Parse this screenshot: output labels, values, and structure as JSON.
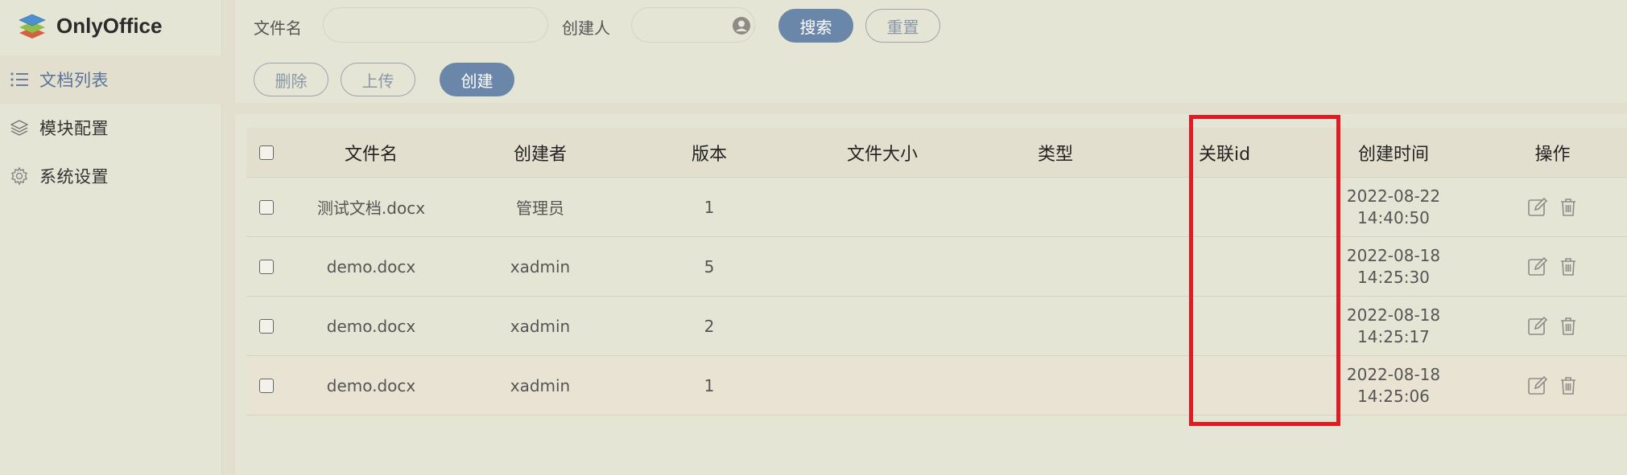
{
  "brand": {
    "name": "OnlyOffice",
    "icon": "stacked-layers-logo-icon"
  },
  "sidebar": {
    "items": [
      {
        "label": "文档列表",
        "icon": "list-icon",
        "active": true
      },
      {
        "label": "模块配置",
        "icon": "layers-icon",
        "active": false
      },
      {
        "label": "系统设置",
        "icon": "gear-icon",
        "active": false
      }
    ]
  },
  "search": {
    "filename_label": "文件名",
    "filename_value": "",
    "creator_label": "创建人",
    "creator_value": "",
    "search_button": "搜索",
    "reset_button": "重置"
  },
  "actions": {
    "delete_button": "删除",
    "upload_button": "上传",
    "create_button": "创建"
  },
  "table": {
    "columns": [
      "文件名",
      "创建者",
      "版本",
      "文件大小",
      "类型",
      "关联id",
      "创建时间",
      "操作"
    ],
    "rows": [
      {
        "filename": "测试文档.docx",
        "creator": "管理员",
        "version": "1",
        "size": "",
        "type": "",
        "related_id": "",
        "date": "2022-08-22",
        "time": "14:40:50"
      },
      {
        "filename": "demo.docx",
        "creator": "xadmin",
        "version": "5",
        "size": "",
        "type": "",
        "related_id": "",
        "date": "2022-08-18",
        "time": "14:25:30"
      },
      {
        "filename": "demo.docx",
        "creator": "xadmin",
        "version": "2",
        "size": "",
        "type": "",
        "related_id": "",
        "date": "2022-08-18",
        "time": "14:25:17"
      },
      {
        "filename": "demo.docx",
        "creator": "xadmin",
        "version": "1",
        "size": "",
        "type": "",
        "related_id": "",
        "date": "2022-08-18",
        "time": "14:25:06"
      }
    ]
  },
  "colors": {
    "background": "#e5e5d6",
    "active_nav_text": "#5a7399",
    "primary_button": "#6a86a8",
    "highlight_box": "#e01b24"
  }
}
